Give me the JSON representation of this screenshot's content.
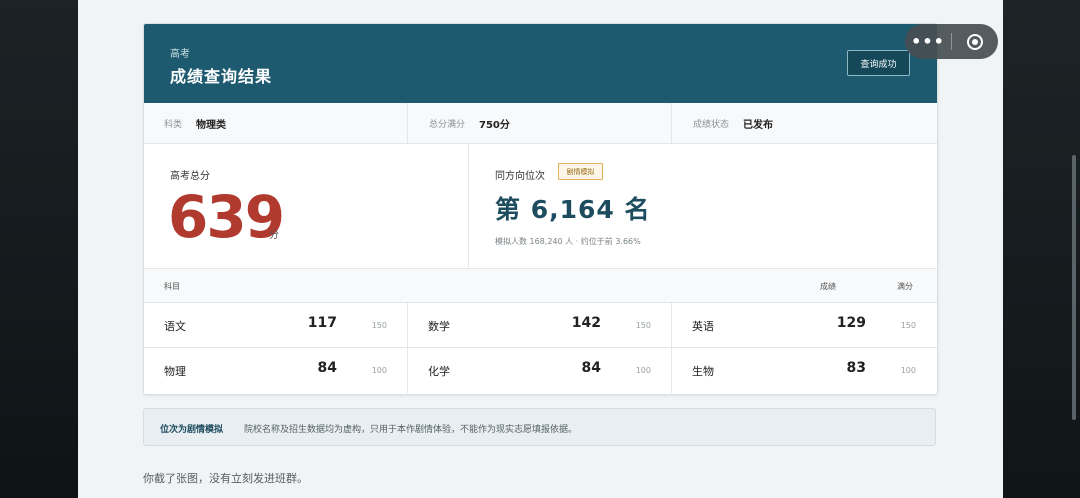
{
  "header": {
    "subtitle": "高考",
    "title": "成绩查询结果",
    "status_button": "查询成功"
  },
  "meta": [
    {
      "label": "科类",
      "value": "物理类"
    },
    {
      "label": "总分满分",
      "value": "750分"
    },
    {
      "label": "成绩状态",
      "value": "已发布"
    }
  ],
  "score": {
    "label": "高考总分",
    "value": "639",
    "unit": "分"
  },
  "rank": {
    "label": "同方向位次",
    "badge": "剧情模拟",
    "value": "第 6,164 名",
    "note": "模拟人数 168,240 人 · 约位于前 3.66%"
  },
  "table": {
    "headers": {
      "subject": "科目",
      "score": "成绩",
      "full": "满分"
    },
    "rows": [
      [
        {
          "subject": "语文",
          "score": "117",
          "full": "150"
        },
        {
          "subject": "数学",
          "score": "142",
          "full": "150"
        },
        {
          "subject": "英语",
          "score": "129",
          "full": "150"
        }
      ],
      [
        {
          "subject": "物理",
          "score": "84",
          "full": "100"
        },
        {
          "subject": "化学",
          "score": "84",
          "full": "100"
        },
        {
          "subject": "生物",
          "score": "83",
          "full": "100"
        }
      ]
    ]
  },
  "notice": {
    "label": "位次为剧情模拟",
    "text": "院校名称及招生数据均为虚构，只用于本作剧情体验，不能作为现实志愿填报依据。"
  },
  "footer_text": "你截了张图，没有立刻发进班群。",
  "capsule": {
    "more_icon": "more-dots-icon",
    "close_icon": "close-target-icon",
    "more_glyph": "•••"
  },
  "colors": {
    "header_bg": "#1e5a6f",
    "score_red": "#b13a2e",
    "rank_blue": "#1e4c5f",
    "badge_border": "#e3b25e"
  }
}
